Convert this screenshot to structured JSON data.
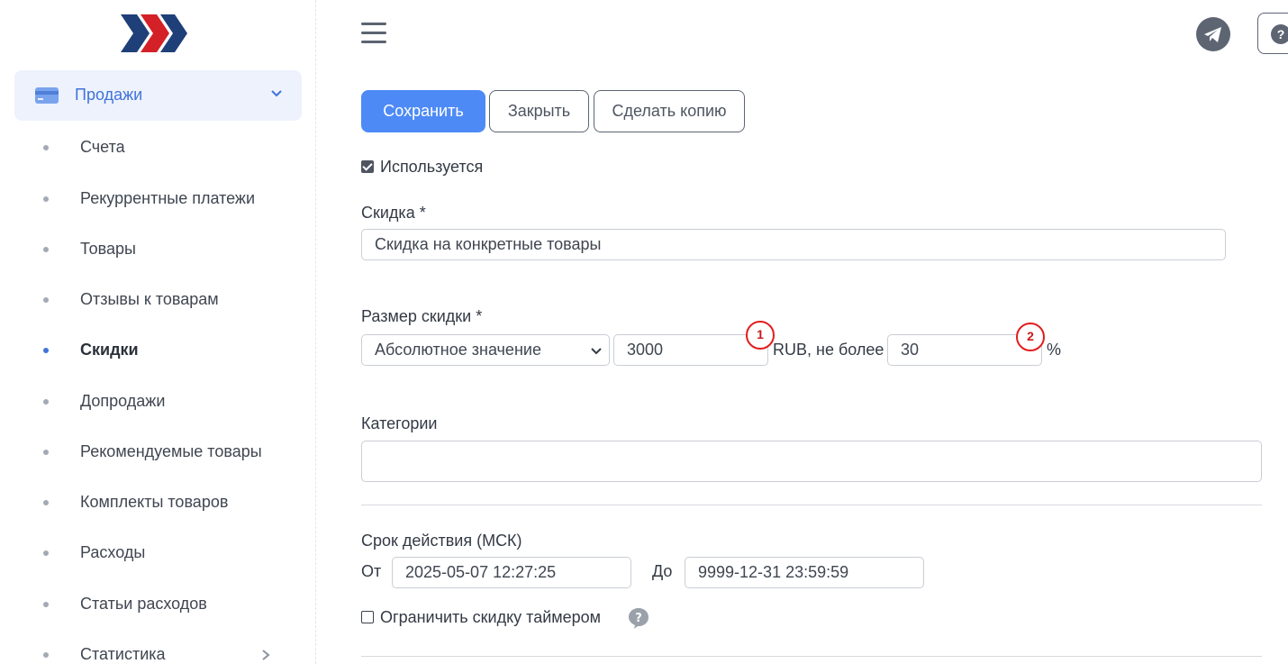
{
  "sidebar": {
    "group": {
      "label": "Продажи",
      "icon": "credit-card-icon"
    },
    "items": [
      {
        "label": "Счета"
      },
      {
        "label": "Рекуррентные платежи"
      },
      {
        "label": "Товары"
      },
      {
        "label": "Отзывы к товарам"
      },
      {
        "label": "Скидки",
        "active": true
      },
      {
        "label": "Допродажи"
      },
      {
        "label": "Рекомендуемые товары"
      },
      {
        "label": "Комплекты товаров"
      },
      {
        "label": "Расходы"
      },
      {
        "label": "Статьи расходов"
      },
      {
        "label": "Статистика",
        "has_submenu": true
      }
    ]
  },
  "header": {
    "menu_icon": "hamburger-icon",
    "telegram_icon": "telegram-icon",
    "help_icon": "help-icon"
  },
  "toolbar": {
    "save_label": "Сохранить",
    "close_label": "Закрыть",
    "copy_label": "Сделать копию"
  },
  "form": {
    "enabled": {
      "label": "Используется",
      "checked": true
    },
    "discount_name": {
      "label": "Скидка *",
      "value": "Скидка на конкретные товары"
    },
    "discount_size": {
      "label": "Размер скидки *",
      "type_value": "Абсолютное значение",
      "amount": "3000",
      "currency_text": "RUB, не более",
      "max_percent": "30",
      "percent_sign": "%"
    },
    "categories": {
      "label": "Категории",
      "value": ""
    },
    "validity": {
      "label": "Срок действия (МСК)",
      "from_label": "От",
      "from_value": "2025-05-07 12:27:25",
      "to_label": "До",
      "to_value": "9999-12-31 23:59:59"
    },
    "timer": {
      "label": "Ограничить скидку таймером",
      "checked": false
    }
  },
  "annotations": {
    "marker1": "1",
    "marker2": "2"
  },
  "colors": {
    "primary": "#4e8af6",
    "accent_nav": "#4173d9",
    "marker": "#e11d1d"
  }
}
